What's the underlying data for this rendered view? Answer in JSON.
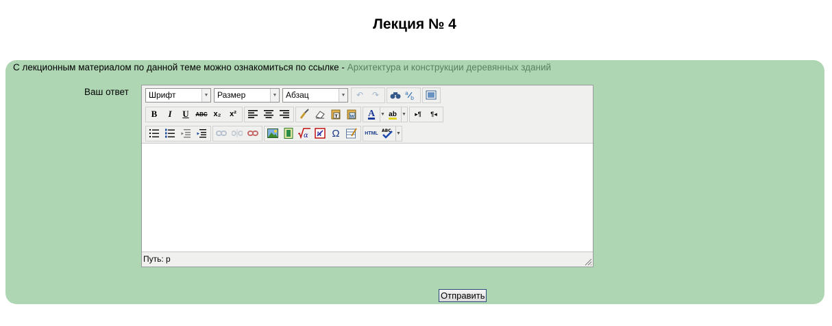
{
  "page": {
    "title": "Лекция № 4"
  },
  "intro": {
    "text": "С лекционным материалом по данной теме можно ознакомиться по ссылке - ",
    "link_text": "Архитектура и конструкции деревянных зданий"
  },
  "form": {
    "answer_label": "Ваш ответ",
    "submit_label": "Отправить"
  },
  "editor": {
    "font_select": "Шрифт",
    "size_select": "Размер",
    "format_select": "Абзац",
    "status_path": "Путь: p",
    "buttons": {
      "bold": "B",
      "italic": "I",
      "underline": "U",
      "strike": "ABC",
      "subscript": "x₂",
      "superscript": "x²",
      "omega": "Ω",
      "html": "HTML",
      "spell": "ABC",
      "ltr": "▸¶",
      "rtl": "¶◂",
      "font_color": "A",
      "highlight": "ab"
    }
  },
  "colors": {
    "panel": "#aed6b3",
    "link": "#5b8063",
    "toolbar": "#f0f0ee"
  }
}
